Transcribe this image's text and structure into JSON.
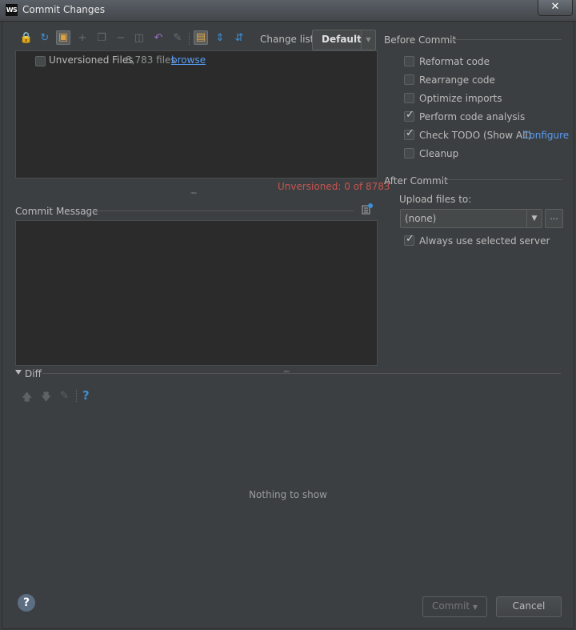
{
  "window": {
    "title": "Commit Changes",
    "logo_text": "WS",
    "close_label": "✕"
  },
  "toolbar": {
    "change_list_label": "Change list:",
    "change_list_value": "Default"
  },
  "files": {
    "unversioned_label": "Unversioned Files",
    "unversioned_count": "8,783 files",
    "browse_link": "browse",
    "status": "Unversioned: 0 of 8783"
  },
  "commit_message": {
    "label": "Commit Message",
    "value": ""
  },
  "diff": {
    "label": "Diff",
    "empty_text": "Nothing to show",
    "help_icon": "?"
  },
  "before_commit": {
    "title": "Before Commit",
    "options": [
      {
        "label": "Reformat code",
        "checked": false
      },
      {
        "label": "Rearrange code",
        "checked": false
      },
      {
        "label": "Optimize imports",
        "checked": false
      },
      {
        "label": "Perform code analysis",
        "checked": true
      },
      {
        "label": "Check TODO (Show All)",
        "checked": true,
        "link": "Configure"
      },
      {
        "label": "Cleanup",
        "checked": false
      }
    ]
  },
  "after_commit": {
    "title": "After Commit",
    "upload_label": "Upload files to:",
    "server_value": "(none)",
    "more_label": "...",
    "always_use_label": "Always use selected server",
    "always_use_checked": true
  },
  "buttons": {
    "help": "?",
    "commit": "Commit",
    "cancel": "Cancel"
  },
  "colors": {
    "background": "#3c3f41",
    "link": "#589df6",
    "warning": "#c75450",
    "accent_icon": "#3d8fd6"
  }
}
